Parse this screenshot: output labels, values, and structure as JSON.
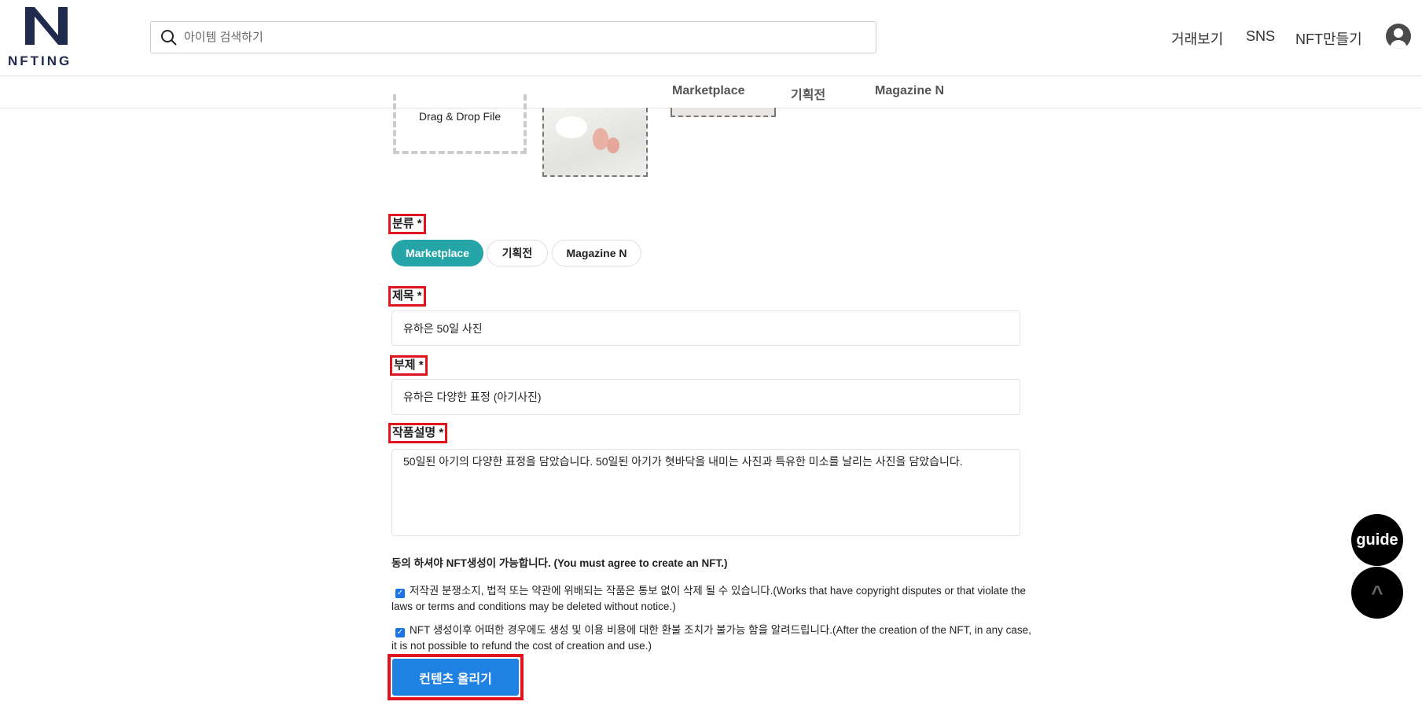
{
  "header": {
    "logo_text": "NFTING",
    "search_placeholder": "아이템 검색하기",
    "nav": [
      "거래보기",
      "SNS",
      "NFT만들기"
    ]
  },
  "subnav": [
    "Marketplace",
    "기획전",
    "Magazine N"
  ],
  "upload": {
    "drop_label": "Drag & Drop File"
  },
  "form": {
    "category_label": "분류 *",
    "categories": [
      "Marketplace",
      "기획전",
      "Magazine N"
    ],
    "selected_category": "Marketplace",
    "title_label": "제목 *",
    "title_value": "유하은 50일 사진",
    "subtitle_label": "부제 *",
    "subtitle_value": "유하은 다양한 표정 (아기사진)",
    "desc_label": "작품설명 *",
    "desc_value": "50일된 아기의 다양한 표정을 담았습니다. 50일된 아기가 혓바닥을 내미는 사진과 특유한 미소를 날리는 사진을 담았습니다.",
    "agree_heading": "동의 하셔야 NFT생성이 가능합니다. (You must agree to create an NFT.)",
    "agree_items": [
      "저작권 분쟁소지, 법적 또는 약관에 위배되는 작품은 통보 없이 삭제 될 수 있습니다.(Works that have copyright disputes or that violate the laws or terms and conditions may be deleted without notice.)",
      "NFT 생성이후 어떠한 경우에도 생성 및 이용 비용에 대한 환불 조치가 불가능 함을 알려드립니다.(After the creation of the NFT, in any case, it is not possible to refund the cost of creation and use.)"
    ],
    "agree_checked": [
      true,
      true
    ],
    "submit_label": "컨텐츠 올리기"
  },
  "floating": {
    "guide_label": "guide",
    "top_label": "^"
  },
  "colors": {
    "accent": "#26a5a8",
    "submit": "#1f82e3",
    "highlight": "#e0141e",
    "logo": "#1f2a4d"
  }
}
